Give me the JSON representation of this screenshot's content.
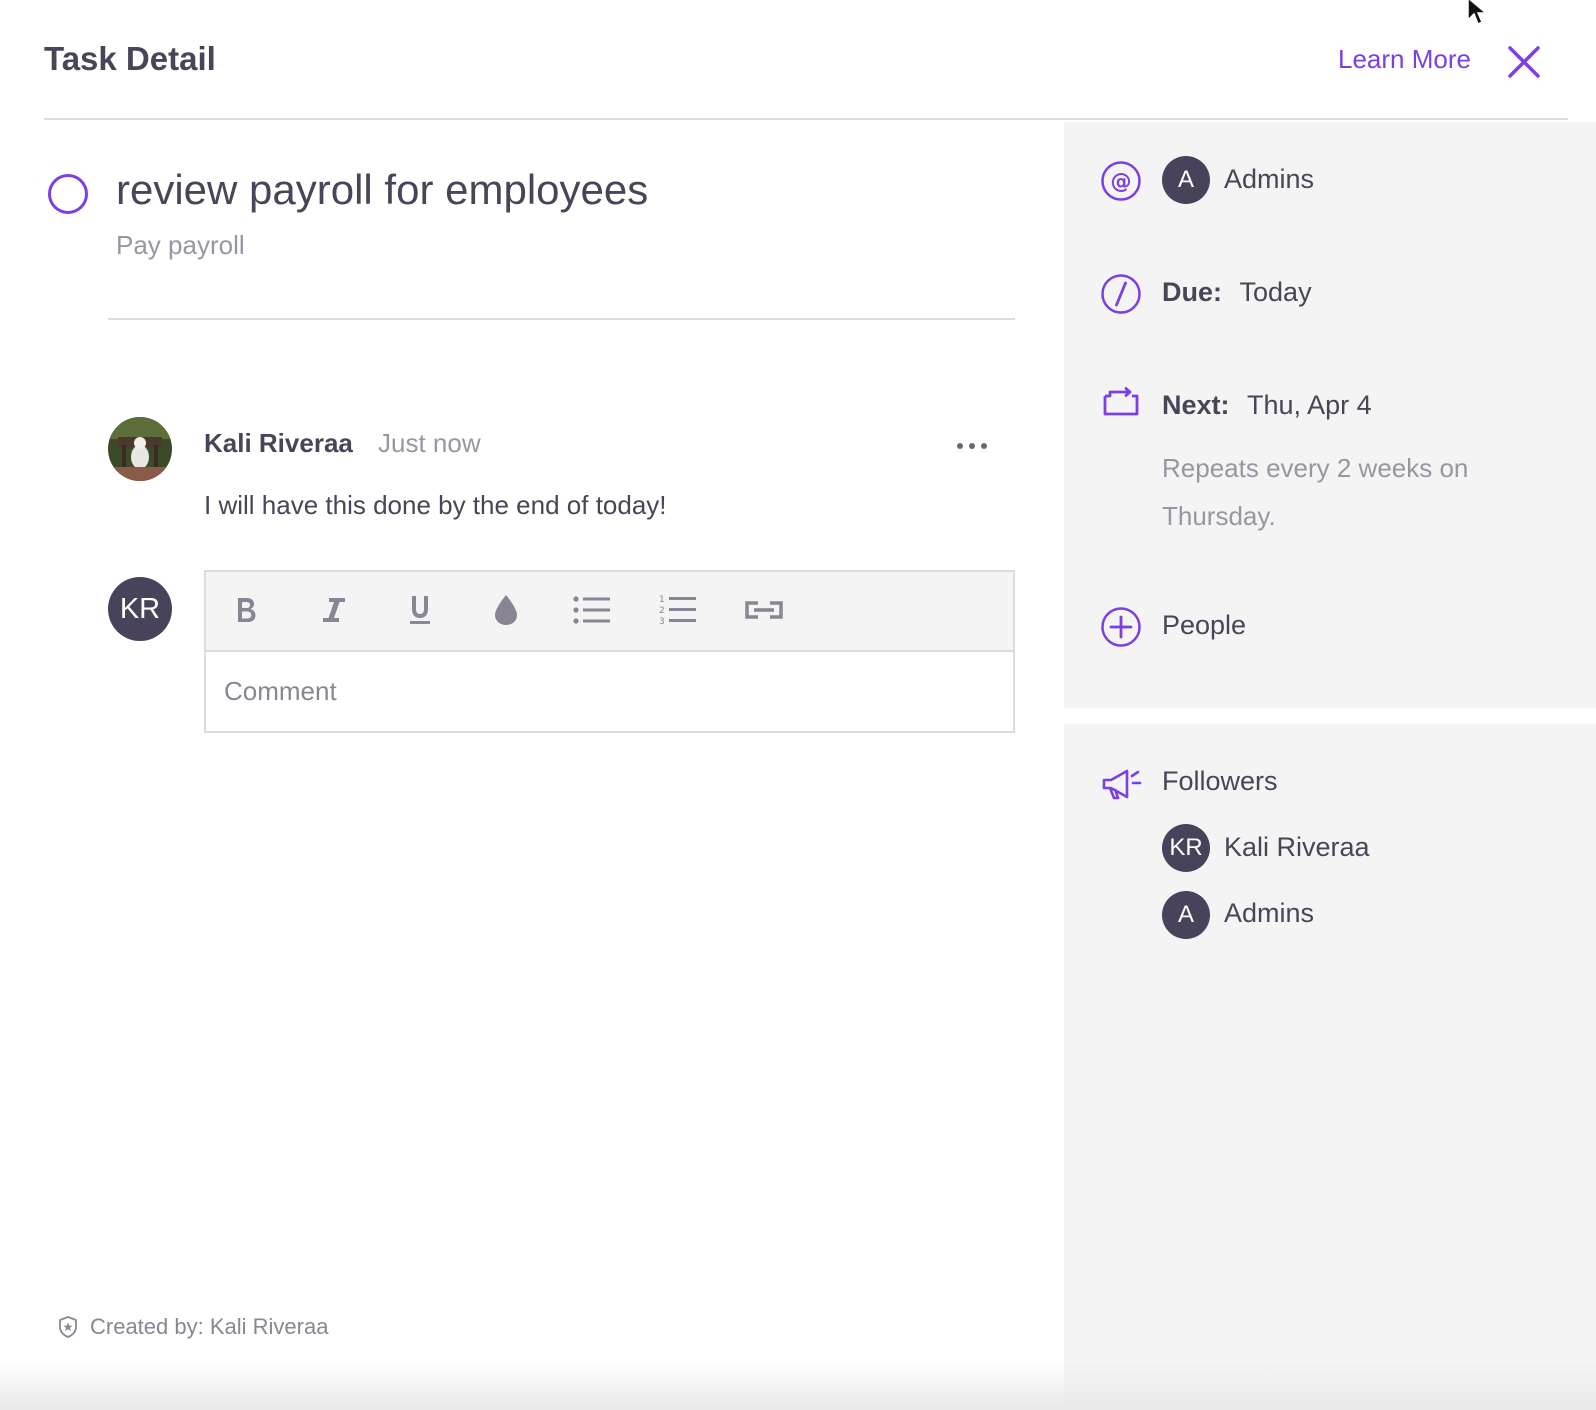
{
  "header": {
    "title": "Task Detail",
    "learn_more": "Learn More",
    "accent_color": "#7b3fe4"
  },
  "task": {
    "title": "review payroll for employees",
    "list_name": "Pay payroll"
  },
  "comment": {
    "author": "Kali Riveraa",
    "time": "Just now",
    "text": "I will have this done by the end of today!"
  },
  "composer": {
    "avatar_initials": "KR",
    "placeholder": "Comment",
    "toolbar": [
      "bold-icon",
      "italic-icon",
      "underline-icon",
      "color-drop-icon",
      "bullet-list-icon",
      "numbered-list-icon",
      "link-icon"
    ]
  },
  "sidebar": {
    "assignee": {
      "initial": "A",
      "name": "Admins"
    },
    "due": {
      "label": "Due:",
      "value": "Today"
    },
    "next": {
      "label": "Next:",
      "value": "Thu, Apr 4",
      "repeat": "Repeats  every 2 weeks on Thursday."
    },
    "people": {
      "label": "People"
    },
    "followers": {
      "label": "Followers",
      "items": [
        {
          "initials": "KR",
          "name": "Kali Riveraa"
        },
        {
          "initials": "A",
          "name": "Admins"
        }
      ]
    }
  },
  "footer": {
    "created_by": "Created by: Kali Riveraa"
  }
}
